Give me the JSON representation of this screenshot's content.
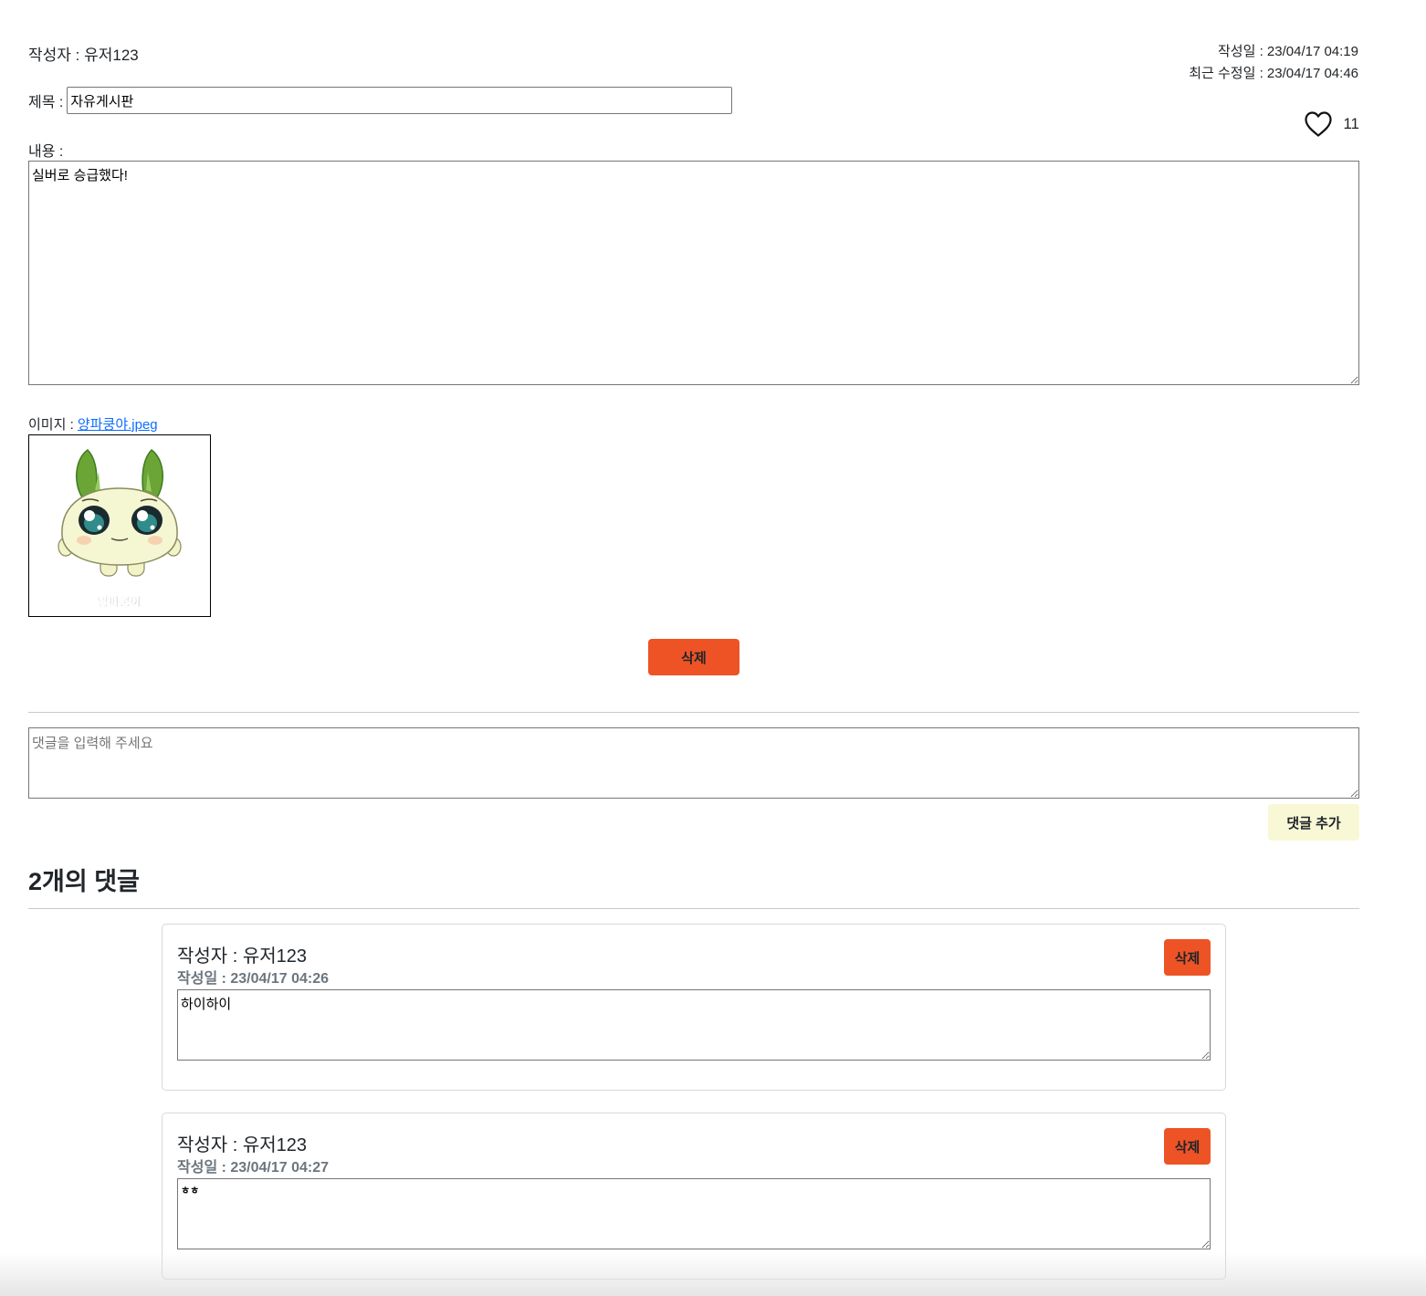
{
  "post": {
    "author_label": "작성자 : 유저123",
    "created_label": "작성일 : 23/04/17 04:19",
    "modified_label": "최근 수정일 : 23/04/17 04:46",
    "title_label": "제목 :",
    "title_value": "자유게시판",
    "like_icon": "heart-outline-icon",
    "like_count": "11",
    "content_label": "내용 :",
    "content_value": "실버로 승급했다!",
    "image_label": "이미지 :",
    "image_filename": "양파쿵야.jpeg",
    "image_caption": "양파쿵야",
    "delete_label": "삭제"
  },
  "comment_form": {
    "placeholder": "댓글을 입력해 주세요",
    "add_label": "댓글 추가"
  },
  "comments": {
    "heading": "2개의 댓글",
    "items": [
      {
        "author": "작성자 : 유저123",
        "date": "작성일 : 23/04/17 04:26",
        "body": "하이하이",
        "delete_label": "삭제"
      },
      {
        "author": "작성자 : 유저123",
        "date": "작성일 : 23/04/17 04:27",
        "body": "ㅎㅎ",
        "delete_label": "삭제"
      }
    ]
  },
  "colors": {
    "delete": "#ee5326",
    "add_comment": "#f8f8d6",
    "link": "#0d6efd",
    "muted": "#6c757d"
  }
}
